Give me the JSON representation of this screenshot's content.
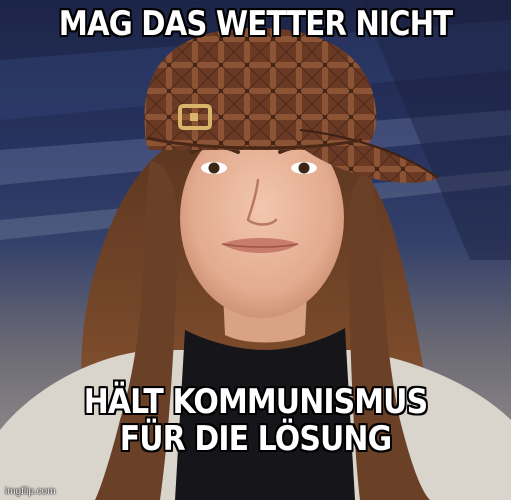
{
  "meme": {
    "top_text": "MAG DAS WETTER NICHT",
    "bottom_text_lines": [
      "HÄLT KOMMUNISMUS",
      "FÜR DIE LÖSUNG"
    ],
    "watermark": "imgflip.com"
  },
  "colors": {
    "caption_fill": "#ffffff",
    "caption_outline": "#000000",
    "cap": "#6b3a24",
    "hair": "#6a4127",
    "skin": "#e9b79d",
    "sweater": "#16161a",
    "background_blue": "#27325e"
  },
  "photo": {
    "description_icon": "woman-with-scumbag-hat"
  }
}
